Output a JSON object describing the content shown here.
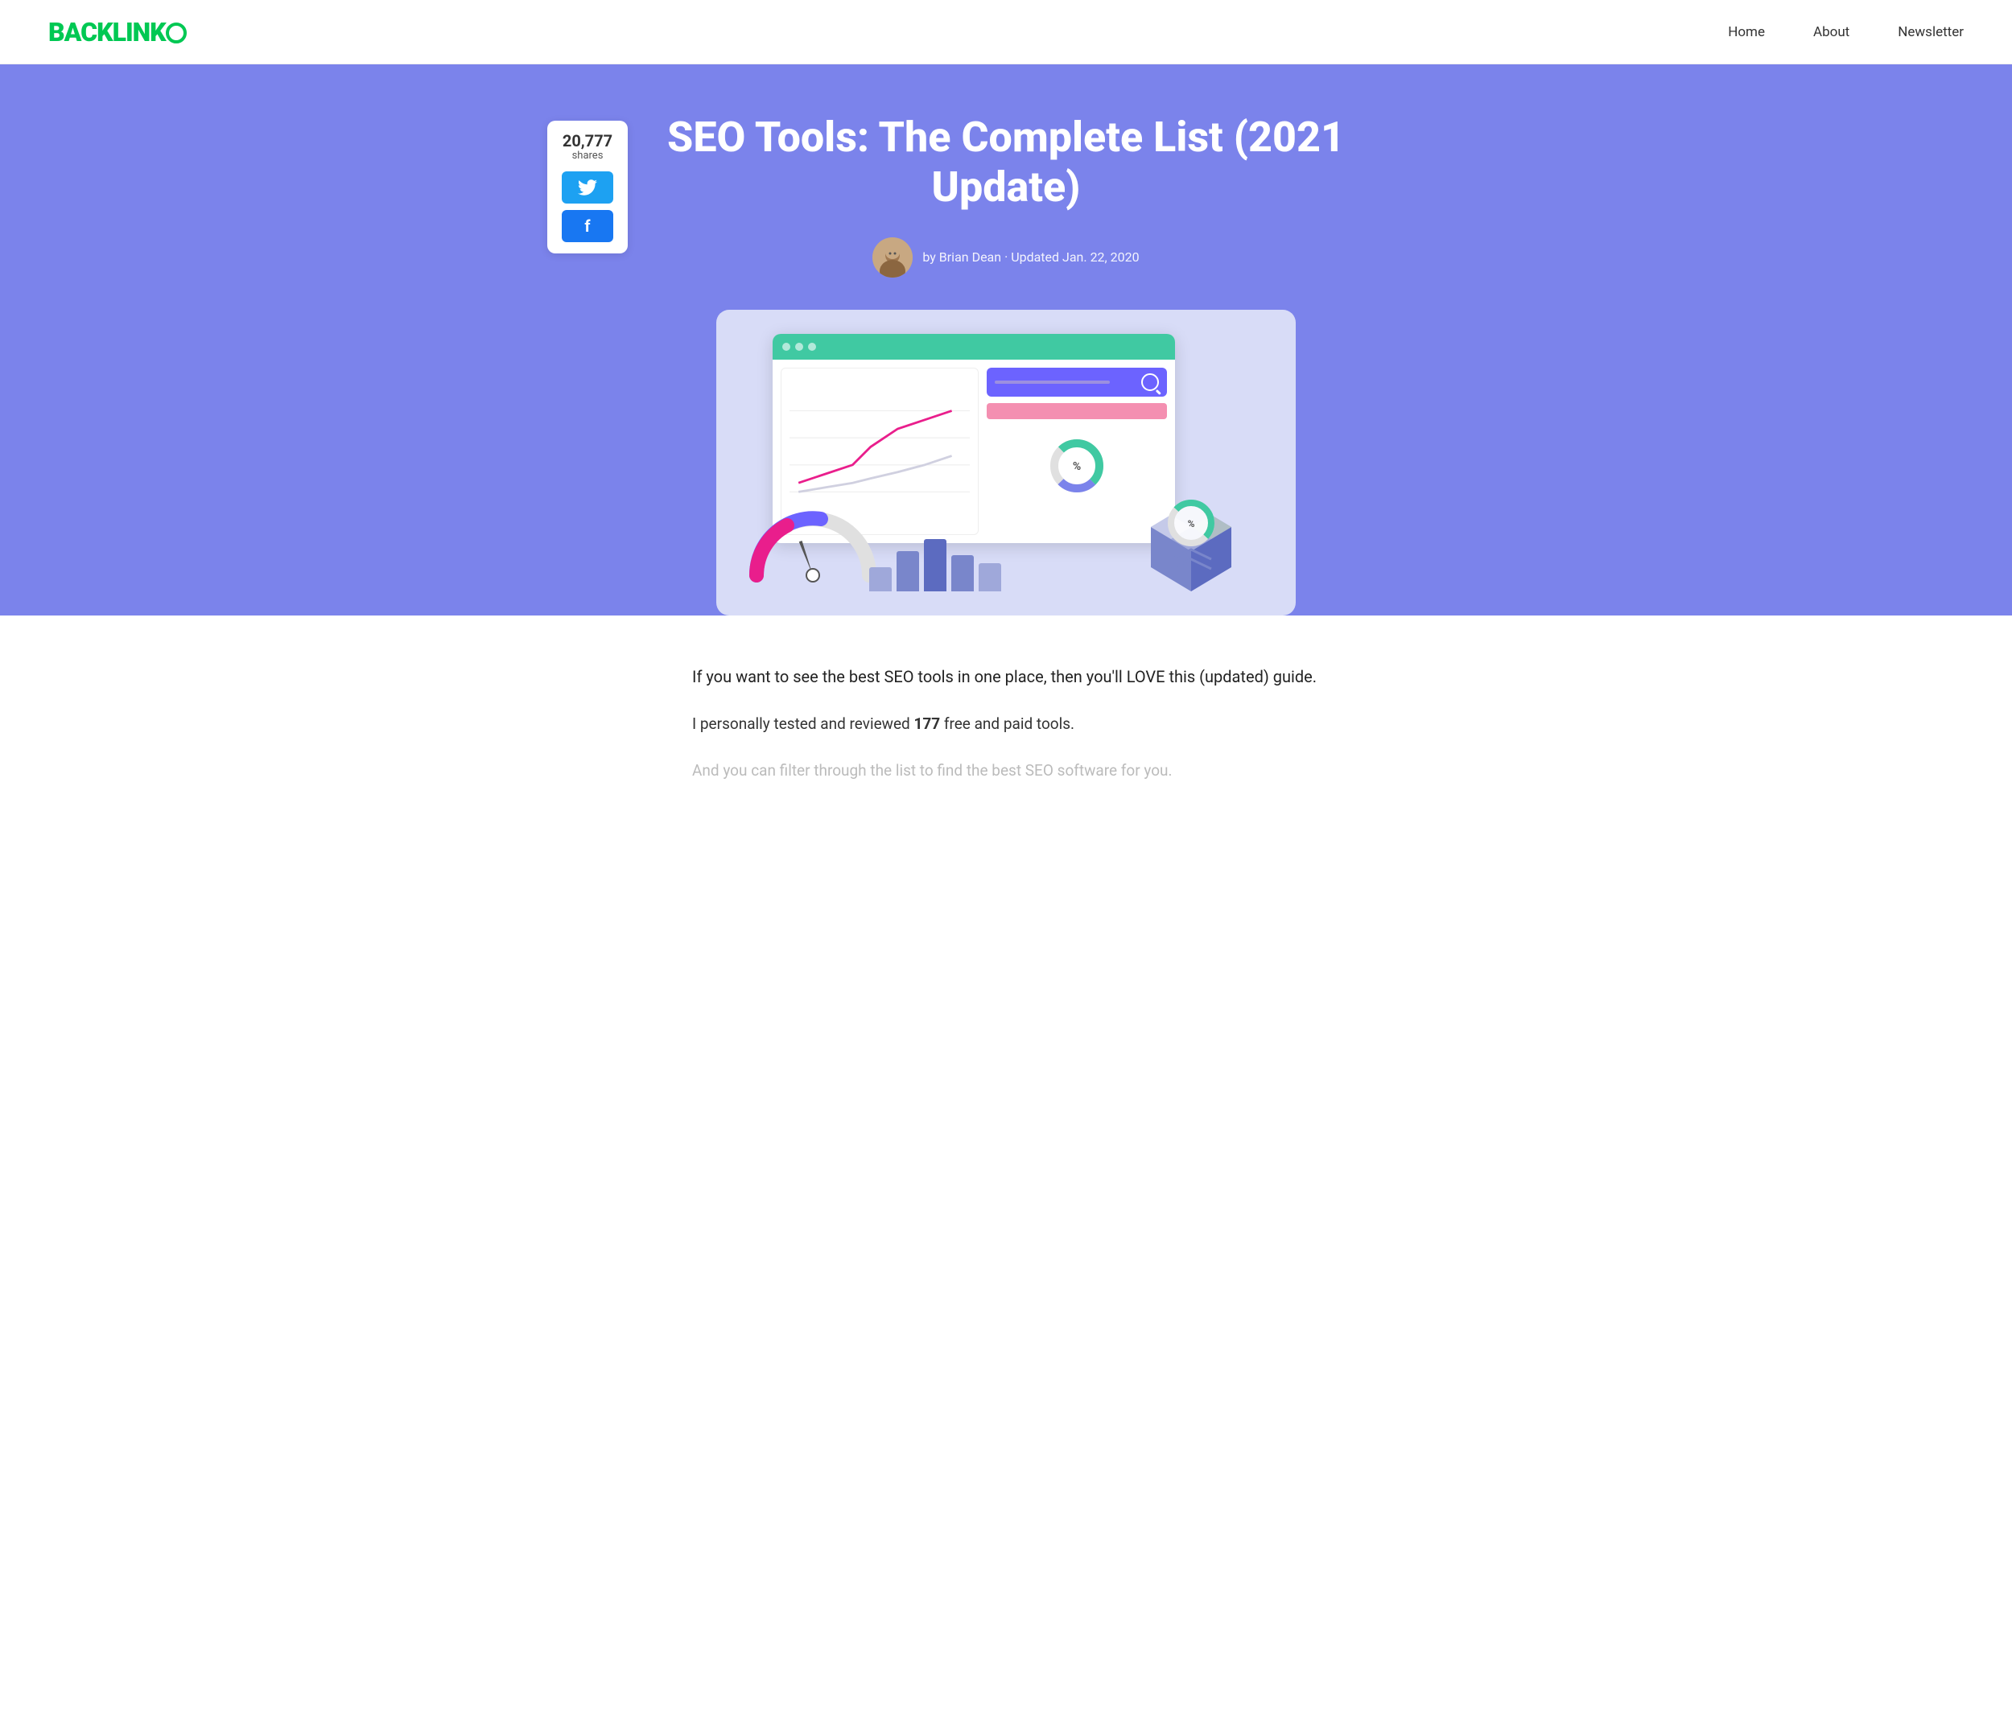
{
  "nav": {
    "logo": "BACKLINK",
    "logo_o": "O",
    "links": [
      {
        "label": "Home",
        "href": "#"
      },
      {
        "label": "About",
        "href": "#"
      },
      {
        "label": "Newsletter",
        "href": "#"
      }
    ]
  },
  "hero": {
    "title": "SEO Tools: The Complete List (2021 Update)",
    "author": "by Brian Dean · Updated Jan. 22, 2020",
    "shares_count": "20,777",
    "shares_label": "shares"
  },
  "content": {
    "intro1": "If you want to see the best SEO tools in one place, then you'll LOVE this (updated) guide.",
    "intro2_prefix": "I personally tested and reviewed ",
    "intro2_number": "177",
    "intro2_suffix": " free and paid tools.",
    "intro3": "And you can filter through the list to find the best SEO software for you."
  }
}
